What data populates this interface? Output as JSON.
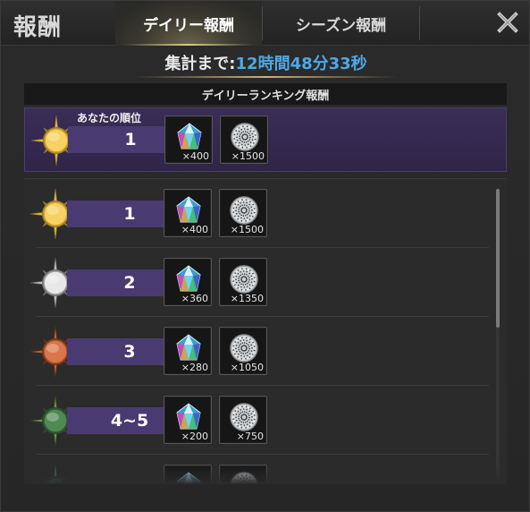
{
  "header": {
    "title": "報酬",
    "tabs": [
      {
        "label": "デイリー報酬",
        "active": true
      },
      {
        "label": "シーズン報酬",
        "active": false
      }
    ],
    "close_icon": "close-icon"
  },
  "timer": {
    "label": "集計まで:",
    "value": "12時間48分33秒"
  },
  "ranking_header": "デイリーランキング報酬",
  "my_rank": {
    "label": "あなたの順位",
    "rank": "1",
    "medal": "gold",
    "rewards": [
      {
        "icon": "crystal-icon",
        "qty": "×400"
      },
      {
        "icon": "silver-coin-icon",
        "qty": "×1500"
      }
    ]
  },
  "rows": [
    {
      "rank": "1",
      "medal": "gold",
      "rewards": [
        {
          "icon": "crystal-icon",
          "qty": "×400"
        },
        {
          "icon": "silver-coin-icon",
          "qty": "×1500"
        }
      ]
    },
    {
      "rank": "2",
      "medal": "silver",
      "rewards": [
        {
          "icon": "crystal-icon",
          "qty": "×360"
        },
        {
          "icon": "silver-coin-icon",
          "qty": "×1350"
        }
      ]
    },
    {
      "rank": "3",
      "medal": "bronze",
      "rewards": [
        {
          "icon": "crystal-icon",
          "qty": "×280"
        },
        {
          "icon": "silver-coin-icon",
          "qty": "×1050"
        }
      ]
    },
    {
      "rank": "4~5",
      "medal": "green",
      "rewards": [
        {
          "icon": "crystal-icon",
          "qty": "×200"
        },
        {
          "icon": "silver-coin-icon",
          "qty": "×750"
        }
      ]
    },
    {
      "rank": "",
      "medal": "teal",
      "rewards": [
        {
          "icon": "crystal-icon",
          "qty": ""
        },
        {
          "icon": "silver-coin-icon",
          "qty": ""
        }
      ]
    }
  ],
  "colors": {
    "accent_blue": "#4ea8e6",
    "ribbon_purple": "#4a3a72",
    "my_rank_bg": "#35294f",
    "gold": "#f2c94c",
    "silver": "#d8d8d8",
    "bronze": "#c8683e",
    "green": "#3f7d45"
  }
}
